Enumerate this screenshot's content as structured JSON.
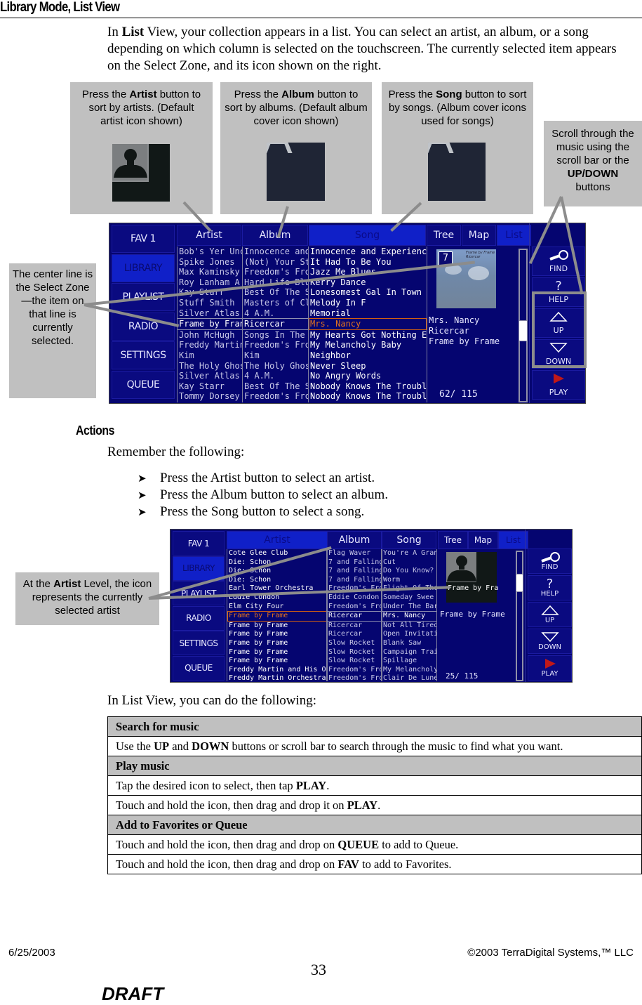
{
  "page": {
    "heading": "Library Mode, List View",
    "intro": {
      "part1": "In ",
      "bold": "List",
      "part2": " View, your collection appears in a list.  You can select an artist, an album, or a song depending on which column is selected on the touchscreen.  The currently selected item appears on the Select Zone, and its icon shown on the right."
    }
  },
  "callouts": {
    "artist": {
      "pre": "Press the ",
      "bold": "Artist",
      "post": " button to sort by artists. (Default artist icon shown)"
    },
    "album": {
      "pre": "Press the ",
      "bold": "Album",
      "post": " button to sort by albums. (Default album cover icon shown)"
    },
    "song": {
      "pre": "Press the ",
      "bold": "Song",
      "post": " button to sort by songs. (Album cover icons used for songs)"
    },
    "scroll": {
      "pre": "Scroll through the music using the scroll bar or the ",
      "bold": "UP/DOWN",
      "post": " buttons"
    },
    "select_zone": {
      "text": "The center line is the Select Zone—the item on that line is currently selected."
    },
    "artist_level": {
      "pre": "At the ",
      "bold": "Artist",
      "post": " Level, the icon represents the currently selected artist"
    }
  },
  "icons": {
    "artist_default": "person-silhouette-icon",
    "album_default": "letter-a-cover-icon",
    "find": "magnifier-icon",
    "help": "question-mark-icon",
    "up": "triangle-up-icon",
    "down": "triangle-down-icon",
    "play": "play-triangle-icon"
  },
  "colors": {
    "screen_bg": "#050570",
    "active_tab": "#1020c8",
    "selected_highlight": "#e07020",
    "play_red": "#c01818",
    "callout_gray": "#c0c0c0"
  },
  "screen1": {
    "side": [
      "FAV 1",
      "LIBRARY",
      "PLAYLIST",
      "RADIO",
      "SETTINGS",
      "QUEUE"
    ],
    "active_side": "LIBRARY",
    "tabs": {
      "artist": "Artist",
      "album": "Album",
      "song": "Song"
    },
    "active_tab": "Song",
    "views": [
      "Tree",
      "Map",
      "List"
    ],
    "active_view": "List",
    "artists": [
      "Bob's Yer Uncl",
      "Spike Jones",
      "Max Kaminsky",
      "Roy Lanham A",
      "Kay Starr",
      "Stuff Smith",
      "Silver Atlas",
      "Frame by Fran",
      "John McHugh",
      "Freddy Martin",
      "Kim",
      "The Holy Ghos",
      "Silver Atlas",
      "Kay Starr",
      "Tommy Dorsey"
    ],
    "albums": [
      "Innocence and",
      "(Not) Your Sta",
      "Freedom's Fro",
      "Hard Life Blue",
      "Best Of The S",
      "Masters of Cla",
      "4 A.M.",
      "Ricercar",
      "Songs In The K",
      "Freedom's Fro",
      "Kim",
      "The Holy Ghos",
      "4 A.M.",
      "Best Of The S",
      "Freedom's Fro"
    ],
    "songs": [
      "Innocence and Experience",
      "It Had To Be You",
      "Jazz Me Blues",
      "Kerry Dance",
      "Lonesomest Gal In Town",
      "Melody In F",
      "Memorial",
      "Mrs. Nancy",
      "My Hearts Got Nothing Els",
      "My Melancholy Baby",
      "Neighbor",
      "Never Sleep",
      "No Angry Words",
      "Nobody Knows The Trouble",
      "Nobody Knows The Trouble"
    ],
    "selected_index": 7,
    "cover_track_number": "7",
    "cover_caption": "Frame by Frame Ricercar",
    "info": [
      "Mrs. Nancy",
      "Ricercar",
      "Frame by Frame"
    ],
    "position": "62/ 115",
    "scroll_fraction": 0.54,
    "right_buttons": [
      "FIND",
      "HELP",
      "UP",
      "DOWN",
      "PLAY"
    ]
  },
  "actions": {
    "heading": "Actions",
    "intro": "Remember the following:",
    "bullets": [
      "Press the Artist button to select an artist.",
      "Press the Album button to select an album.",
      "Press the Song button to select a song."
    ]
  },
  "screen2": {
    "side": [
      "FAV 1",
      "LIBRARY",
      "PLAYLIST",
      "RADIO",
      "SETTINGS",
      "QUEUE"
    ],
    "active_side": "LIBRARY",
    "tabs": {
      "artist": "Artist",
      "album": "Album",
      "song": "Song"
    },
    "active_tab": "Artist",
    "views": [
      "Tree",
      "Map",
      "List"
    ],
    "active_view": "List",
    "artists": [
      "Cote Glee Club",
      "Die: Schon",
      "Die: Schon",
      "Die: Schon",
      "Earl Tower Orchestra",
      "Eddie Condon",
      "Elm City Four",
      "Frame by Frame",
      "Frame by Frame",
      "Frame by Frame",
      "Frame by Frame",
      "Frame by Frame",
      "Frame by Frame",
      "Freddy Martin and His Orc",
      "Freddy Martin Orchestra"
    ],
    "albums": [
      "Flag Waver",
      "7 and Falling",
      "7 and Falling",
      "7 and Falling",
      "Freedom's Fro",
      "Eddie Condon &",
      "Freedom's Fro",
      "Ricercar",
      "Ricercar",
      "Ricercar",
      "Slow Rocket",
      "Slow Rocket",
      "Slow Rocket",
      "Freedom's Fro",
      "Freedom's Fro"
    ],
    "songs": [
      "You're A Granc",
      "Cut",
      "Do You Know?",
      "Worm",
      "Flight Of The",
      "Someday Swee",
      "Under The Bar",
      "Mrs. Nancy",
      "Not All Tired",
      "Open Invitatior",
      "Blank Saw",
      "Campaign Trai",
      "Spillage",
      "My Melancholy",
      "Clair De Lune"
    ],
    "selected_index": 7,
    "icon_caption": "Frame by Fra",
    "info": [
      "Frame by Frame"
    ],
    "position": "25/ 115",
    "scroll_fraction": 0.2,
    "right_buttons": [
      "FIND",
      "HELP",
      "UP",
      "DOWN",
      "PLAY"
    ]
  },
  "list_view": {
    "intro": "In List View, you can do the following:",
    "sections": [
      {
        "title": "Search for music",
        "rows": [
          [
            {
              "t": "Use the "
            },
            {
              "b": "UP"
            },
            {
              "t": " and "
            },
            {
              "b": "DOWN"
            },
            {
              "t": " buttons or scroll bar to search through the music to find what you want."
            }
          ]
        ]
      },
      {
        "title": "Play music",
        "rows": [
          [
            {
              "t": "Tap the desired icon to select, then tap "
            },
            {
              "b": "PLAY"
            },
            {
              "t": "."
            }
          ],
          [
            {
              "t": "Touch and hold the icon, then drag and drop it on "
            },
            {
              "b": "PLAY"
            },
            {
              "t": "."
            }
          ]
        ]
      },
      {
        "title": "Add to Favorites or Queue",
        "rows": [
          [
            {
              "t": "Touch and hold the icon, then drag and drop on "
            },
            {
              "b": "QUEUE"
            },
            {
              "t": " to add to Queue."
            }
          ],
          [
            {
              "t": "Touch and hold the icon, then drag and drop on "
            },
            {
              "b": "FAV"
            },
            {
              "t": " to add to Favorites."
            }
          ]
        ]
      }
    ]
  },
  "footer": {
    "date": "6/25/2003",
    "copyright": "©2003 TerraDigital Systems,™ LLC",
    "page_number": "33",
    "draft": "DRAFT"
  }
}
